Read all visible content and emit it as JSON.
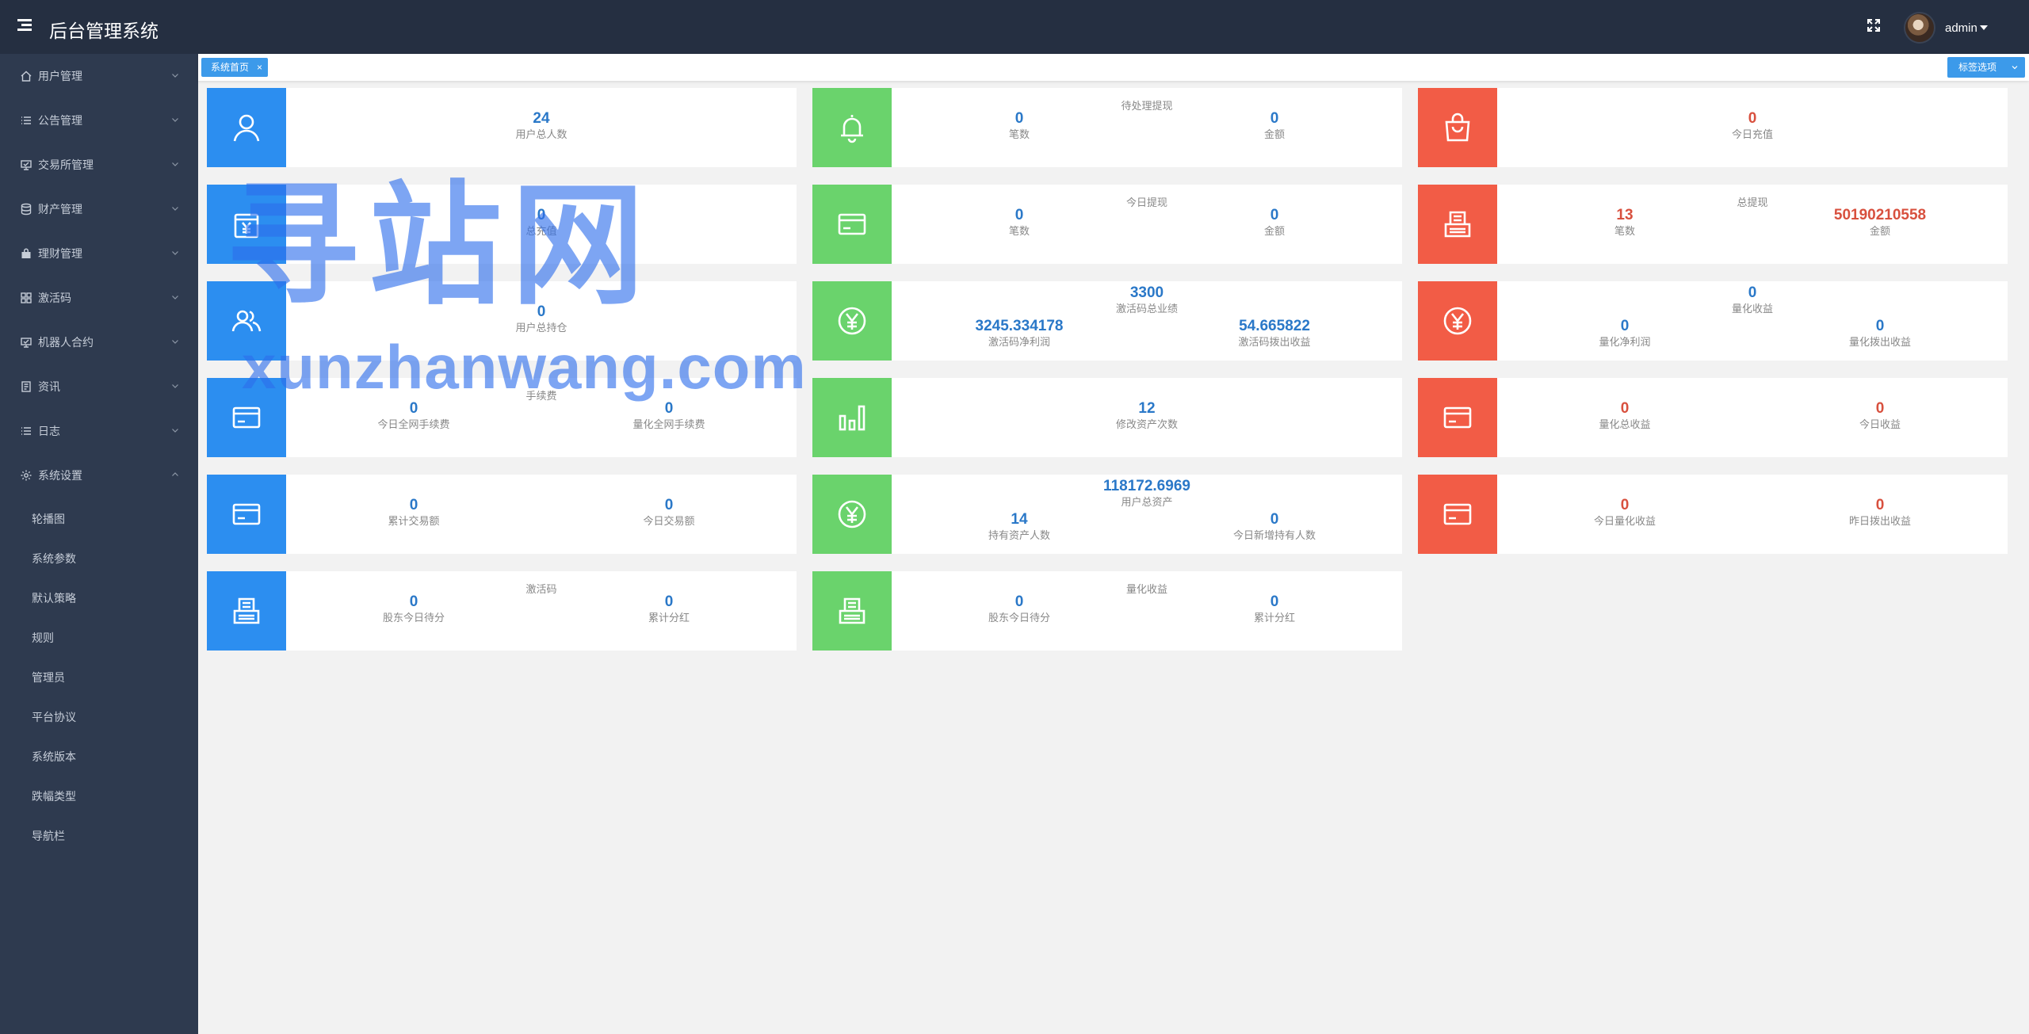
{
  "header": {
    "title": "后台管理系统",
    "user": "admin"
  },
  "sidebar": {
    "items": [
      {
        "label": "用户管理",
        "icon": "home-icon"
      },
      {
        "label": "公告管理",
        "icon": "list-icon"
      },
      {
        "label": "交易所管理",
        "icon": "monitor-icon"
      },
      {
        "label": "财产管理",
        "icon": "database-icon"
      },
      {
        "label": "理财管理",
        "icon": "bag-icon"
      },
      {
        "label": "激活码",
        "icon": "grid-icon"
      },
      {
        "label": "机器人合约",
        "icon": "monitor-icon"
      },
      {
        "label": "资讯",
        "icon": "document-icon"
      },
      {
        "label": "日志",
        "icon": "list-icon"
      },
      {
        "label": "系统设置",
        "icon": "gear-icon"
      }
    ],
    "sub_items": [
      "轮播图",
      "系统参数",
      "默认策略",
      "规则",
      "管理员",
      "平台协议",
      "系统版本",
      "跌幅类型",
      "导航栏"
    ]
  },
  "tabs": {
    "home": "系统首页",
    "close": "×",
    "options": "标签选项"
  },
  "cards": {
    "c1": {
      "stats": [
        {
          "value": "24",
          "label": "用户总人数"
        }
      ]
    },
    "c2": {
      "title": "待处理提现",
      "stats": [
        {
          "value": "0",
          "label": "笔数"
        },
        {
          "value": "0",
          "label": "金额"
        }
      ]
    },
    "c3": {
      "stats": [
        {
          "value": "0",
          "label": "今日充值"
        }
      ]
    },
    "c4": {
      "stats": [
        {
          "value": "0",
          "label": "总充值"
        }
      ]
    },
    "c5": {
      "title": "今日提现",
      "stats": [
        {
          "value": "0",
          "label": "笔数"
        },
        {
          "value": "0",
          "label": "金额"
        }
      ]
    },
    "c6": {
      "title": "总提现",
      "stats": [
        {
          "value": "13",
          "label": "笔数"
        },
        {
          "value": "50190210558",
          "label": "金额"
        }
      ]
    },
    "c7": {
      "stats": [
        {
          "value": "0",
          "label": "用户总持仓"
        }
      ]
    },
    "c8": {
      "stats": [
        {
          "value": "3300",
          "label": "激活码总业绩"
        },
        {
          "value": "3245.334178",
          "label": "激活码净利润"
        },
        {
          "value": "54.665822",
          "label": "激活码拨出收益"
        }
      ]
    },
    "c9": {
      "stats": [
        {
          "value": "0",
          "label": "量化收益"
        },
        {
          "value": "0",
          "label": "量化净利润"
        },
        {
          "value": "0",
          "label": "量化拨出收益"
        }
      ]
    },
    "c10": {
      "title": "手续费",
      "stats": [
        {
          "value": "0",
          "label": "今日全网手续费"
        },
        {
          "value": "0",
          "label": "量化全网手续费"
        }
      ]
    },
    "c11": {
      "stats": [
        {
          "value": "12",
          "label": "修改资产次数"
        }
      ]
    },
    "c12": {
      "stats": [
        {
          "value": "0",
          "label": "量化总收益"
        },
        {
          "value": "0",
          "label": "今日收益"
        }
      ]
    },
    "c13": {
      "stats": [
        {
          "value": "0",
          "label": "累计交易额"
        },
        {
          "value": "0",
          "label": "今日交易额"
        }
      ]
    },
    "c14": {
      "stats": [
        {
          "value": "118172.6969",
          "label": "用户总资产"
        },
        {
          "value": "14",
          "label": "持有资产人数"
        },
        {
          "value": "0",
          "label": "今日新增持有人数"
        }
      ]
    },
    "c15": {
      "stats": [
        {
          "value": "0",
          "label": "今日量化收益"
        },
        {
          "value": "0",
          "label": "昨日拨出收益"
        }
      ]
    },
    "c16": {
      "title": "激活码",
      "stats": [
        {
          "value": "0",
          "label": "股东今日待分"
        },
        {
          "value": "0",
          "label": "累计分红"
        }
      ]
    },
    "c17": {
      "title": "量化收益",
      "stats": [
        {
          "value": "0",
          "label": "股东今日待分"
        },
        {
          "value": "0",
          "label": "累计分红"
        }
      ]
    }
  },
  "watermark": {
    "cn": "寻站网",
    "en": "xunzhanwang.com"
  },
  "colors": {
    "header": "#252f41",
    "sidebar": "#2e3a4f",
    "blue": "#2c8ef0",
    "green": "#6ad36c",
    "red": "#f25c46",
    "accent": "#3c9aea"
  }
}
